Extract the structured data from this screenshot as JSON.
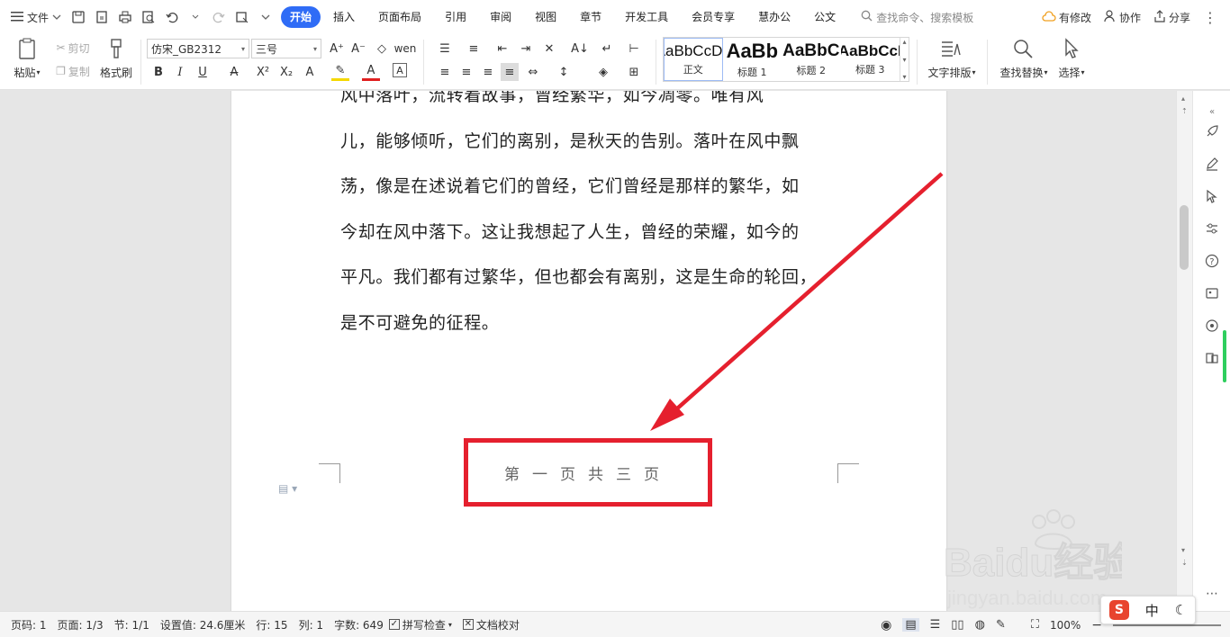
{
  "menubar": {
    "file_label": "文件",
    "tabs": [
      "开始",
      "插入",
      "页面布局",
      "引用",
      "审阅",
      "视图",
      "章节",
      "开发工具",
      "会员专享",
      "慧办公",
      "公文"
    ],
    "active_tab": "开始",
    "search_placeholder": "查找命令、搜索模板",
    "right": {
      "modified": "有修改",
      "collab": "协作",
      "share": "分享"
    }
  },
  "ribbon": {
    "paste": "粘贴",
    "cut": "剪切",
    "copy": "复制",
    "format_painter": "格式刷",
    "font_name": "仿宋_GB2312",
    "font_size": "三号",
    "styles": [
      {
        "sample": "AaBbCcDd",
        "name": "正文"
      },
      {
        "sample": "AaBb",
        "name": "标题 1"
      },
      {
        "sample": "AaBbC",
        "name": "标题 2"
      },
      {
        "sample": "AaBbCcI",
        "name": "标题 3"
      }
    ],
    "text_layout": "文字排版",
    "find_replace": "查找替换",
    "select": "选择"
  },
  "document": {
    "lines": [
      "    风中落叶，流转着故事，曾经繁华，如今凋零。唯有风",
      "儿，能够倾听，它们的离别，是秋天的告别。落叶在风中飘",
      "荡，像是在述说着它们的曾经，它们曾经是那样的繁华，如",
      "今却在风中落下。这让我想起了人生，曾经的荣耀，如今的",
      "平凡。我们都有过繁华，但也都会有离别，这是生命的轮回，",
      "是不可避免的征程。"
    ],
    "footer": "第一页共三页",
    "accent_color": "#e5202e"
  },
  "statusbar": {
    "page": "页码: 1",
    "pages": "页面: 1/3",
    "section": "节: 1/1",
    "setting": "设置值: 24.6厘米",
    "row": "行: 15",
    "col": "列: 1",
    "words": "字数: 649",
    "spellcheck": "拼写检查",
    "proofread": "文档校对",
    "zoom": "100%"
  },
  "ime": {
    "mode": "中"
  },
  "watermark": {
    "brand": "Baidu经验",
    "url": "jingyan.baidu.com"
  }
}
